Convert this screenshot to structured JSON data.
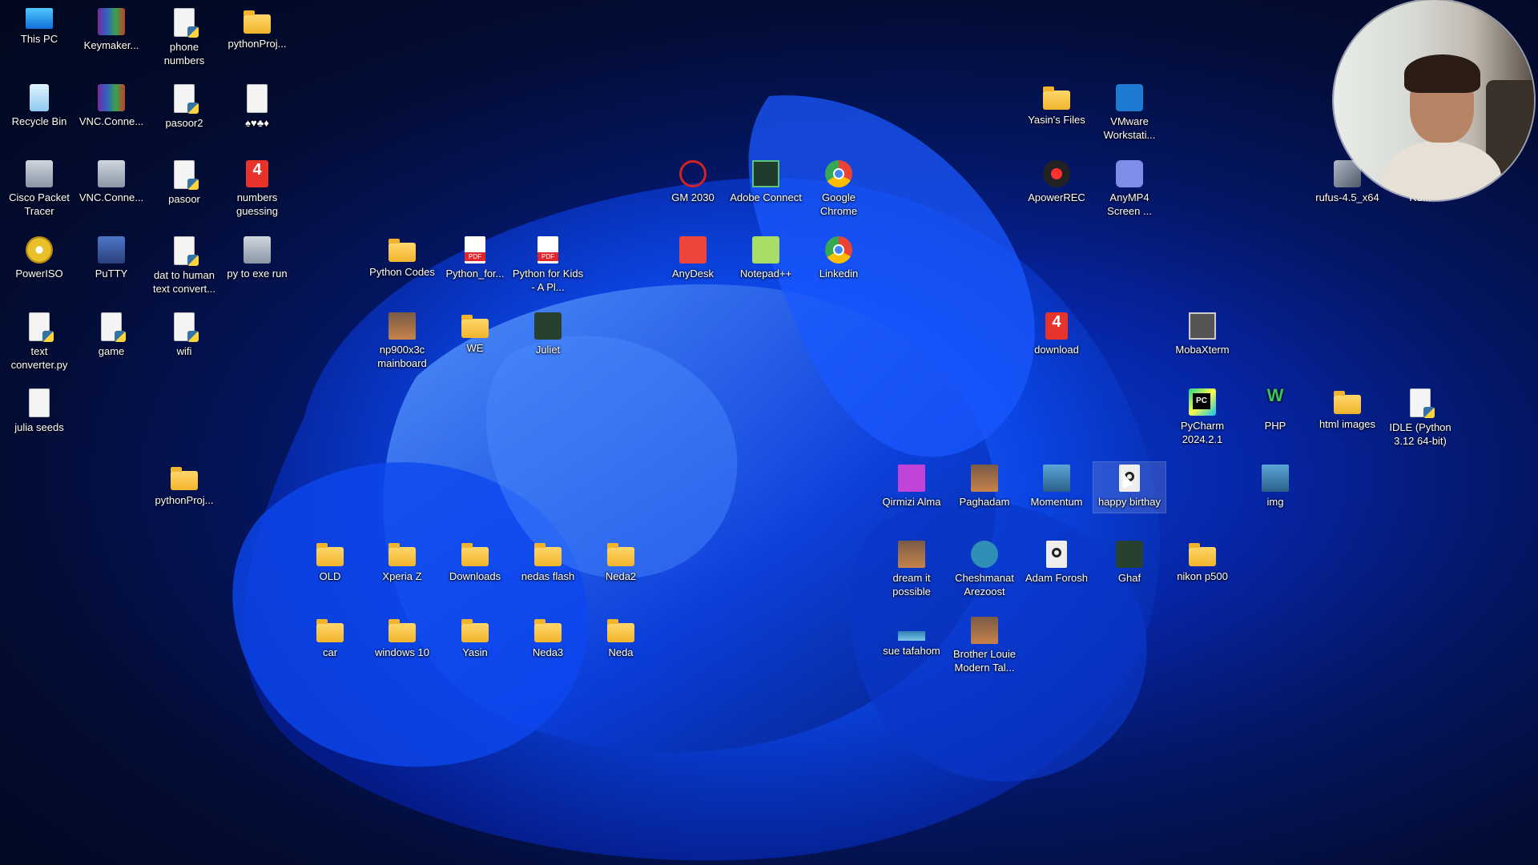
{
  "desktop": {
    "icons": [
      {
        "label": "This PC",
        "icon": "computer-icon"
      },
      {
        "label": "Keymaker...",
        "icon": "winrar-icon"
      },
      {
        "label": "phone numbers",
        "icon": "python-file-icon"
      },
      {
        "label": "pythonProj...",
        "icon": "folder-icon"
      },
      {
        "label": "Recycle Bin",
        "icon": "recycle-bin-icon"
      },
      {
        "label": "VNC.Conne...",
        "icon": "winrar-icon"
      },
      {
        "label": "pasoor2",
        "icon": "python-file-icon"
      },
      {
        "label": "♠♥♣♦",
        "icon": "text-file-icon"
      },
      {
        "label": "Cisco Packet Tracer",
        "icon": "cisco-packet-tracer-icon"
      },
      {
        "label": "VNC.Conne...",
        "icon": "vnc-setup-icon"
      },
      {
        "label": "pasoor",
        "icon": "python-file-icon"
      },
      {
        "label": "numbers guessing",
        "icon": "number-app-icon"
      },
      {
        "label": "PowerISO",
        "icon": "poweriso-icon"
      },
      {
        "label": "PuTTY",
        "icon": "putty-icon"
      },
      {
        "label": "dat to human text convert...",
        "icon": "python-file-icon"
      },
      {
        "label": "py to exe run",
        "icon": "tool-icon"
      },
      {
        "label": "text converter.py",
        "icon": "python-script-icon"
      },
      {
        "label": "game",
        "icon": "python-file-icon"
      },
      {
        "label": "wifi",
        "icon": "python-file-icon"
      },
      {
        "label": "julia seeds",
        "icon": "text-file-icon"
      },
      {
        "label": "pythonProj...",
        "icon": "folder-icon"
      },
      {
        "label": "Python Codes",
        "icon": "folder-icon"
      },
      {
        "label": "Python_for...",
        "icon": "pdf-icon"
      },
      {
        "label": "Python for Kids - A Pl...",
        "icon": "pdf-icon"
      },
      {
        "label": "np900x3c mainboard",
        "icon": "image-icon"
      },
      {
        "label": "WE",
        "icon": "folder-icon"
      },
      {
        "label": "Juliet",
        "icon": "juliet-icon"
      },
      {
        "label": "GM 2030",
        "icon": "gm-icon"
      },
      {
        "label": "Adobe Connect",
        "icon": "adobe-connect-icon"
      },
      {
        "label": "Google Chrome",
        "icon": "chrome-icon"
      },
      {
        "label": "AnyDesk",
        "icon": "anydesk-icon"
      },
      {
        "label": "Notepad++",
        "icon": "notepad-plus-plus-icon"
      },
      {
        "label": "Linkedin",
        "icon": "chrome-icon"
      },
      {
        "label": "OLD",
        "icon": "folder-icon"
      },
      {
        "label": "Xperia Z",
        "icon": "folder-icon"
      },
      {
        "label": "Downloads",
        "icon": "folder-icon"
      },
      {
        "label": "nedas flash",
        "icon": "folder-icon"
      },
      {
        "label": "Neda2",
        "icon": "folder-icon"
      },
      {
        "label": "car",
        "icon": "folder-icon"
      },
      {
        "label": "windows 10",
        "icon": "folder-icon"
      },
      {
        "label": "Yasin",
        "icon": "folder-icon"
      },
      {
        "label": "Neda3",
        "icon": "folder-icon"
      },
      {
        "label": "Neda",
        "icon": "folder-icon"
      },
      {
        "label": "Yasin's Files",
        "icon": "folder-icon"
      },
      {
        "label": "VMware Workstati...",
        "icon": "vmware-icon"
      },
      {
        "label": "ApowerREC",
        "icon": "apowerrec-icon"
      },
      {
        "label": "AnyMP4 Screen ...",
        "icon": "anymp4-icon"
      },
      {
        "label": "rufus-4.5_x64",
        "icon": "usb-icon"
      },
      {
        "label": "Ru...",
        "icon": "usb-icon"
      },
      {
        "label": "download",
        "icon": "number-app-icon"
      },
      {
        "label": "MobaXterm",
        "icon": "mobaxterm-icon"
      },
      {
        "label": "PyCharm 2024.2.1",
        "icon": "pycharm-icon"
      },
      {
        "label": "PHP",
        "icon": "php-icon"
      },
      {
        "label": "html images",
        "icon": "folder-icon"
      },
      {
        "label": "IDLE (Python 3.12 64-bit)",
        "icon": "python-file-icon"
      },
      {
        "label": "Qirmizi Alma",
        "icon": "image-icon"
      },
      {
        "label": "Paghadam",
        "icon": "image-icon"
      },
      {
        "label": "Momentum",
        "icon": "image-icon"
      },
      {
        "label": "happy birthay",
        "icon": "video-file-icon",
        "selected": true
      },
      {
        "label": "img",
        "icon": "image-icon"
      },
      {
        "label": "dream it possible",
        "icon": "image-icon"
      },
      {
        "label": "Cheshmanat Arezoost",
        "icon": "media-icon"
      },
      {
        "label": "Adam Forosh",
        "icon": "video-file-icon"
      },
      {
        "label": "Ghaf",
        "icon": "image-icon"
      },
      {
        "label": "nikon p500",
        "icon": "folder-icon"
      },
      {
        "label": "sue tafahom",
        "icon": "image-icon"
      },
      {
        "label": "Brother Louie Modern Tal...",
        "icon": "image-icon"
      }
    ]
  },
  "colors": {
    "background": "#030c34",
    "wallpaper_bloom": "#0a3fd6",
    "label_text": "#ffffff"
  }
}
